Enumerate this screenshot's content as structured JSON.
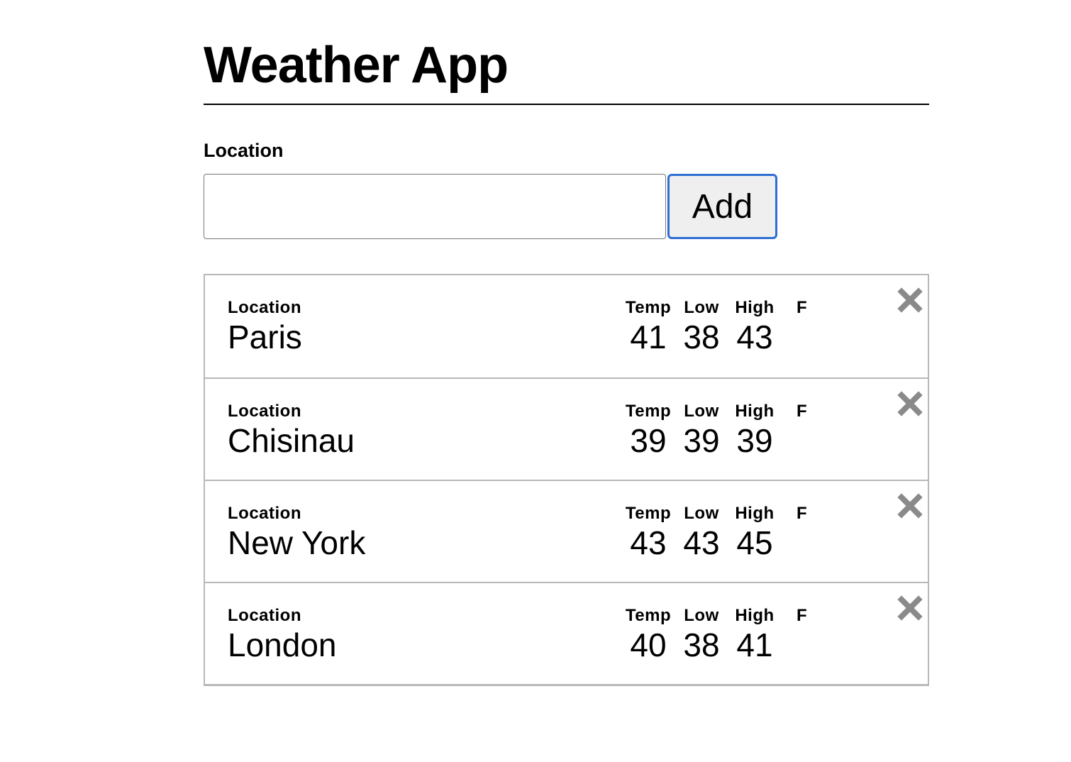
{
  "app": {
    "title": "Weather App"
  },
  "form": {
    "label": "Location",
    "input_value": "",
    "input_placeholder": "",
    "add_label": "Add"
  },
  "card_labels": {
    "location": "Location",
    "temp": "Temp",
    "low": "Low",
    "high": "High",
    "unit": "F"
  },
  "remove_icon": "close-x-icon",
  "colors": {
    "button_focus_border": "#2f6ed3",
    "remove_icon": "#8a8a8a",
    "card_border": "#b8b8b8"
  },
  "locations": [
    {
      "name": "Paris",
      "temp": "41",
      "low": "38",
      "high": "43"
    },
    {
      "name": "Chisinau",
      "temp": "39",
      "low": "39",
      "high": "39"
    },
    {
      "name": "New York",
      "temp": "43",
      "low": "43",
      "high": "45"
    },
    {
      "name": "London",
      "temp": "40",
      "low": "38",
      "high": "41"
    }
  ]
}
